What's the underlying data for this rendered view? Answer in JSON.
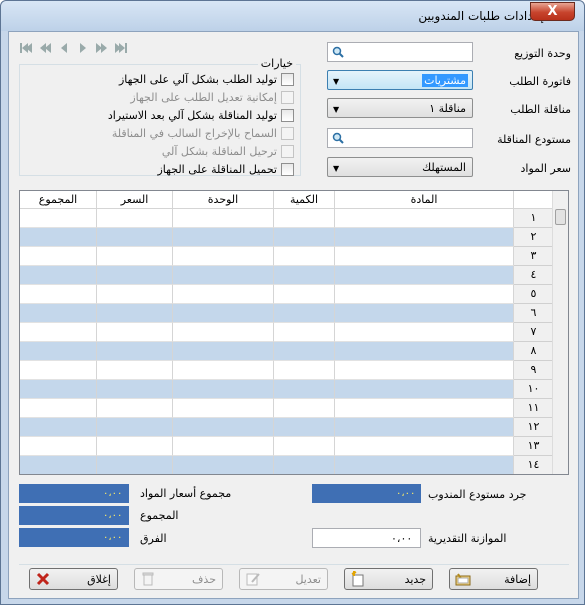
{
  "window": {
    "title": "إعدادات طلبات المندوبين",
    "close_label": "X"
  },
  "nav": {
    "first": "first-record",
    "prev": "prev-record",
    "next": "next-record",
    "last": "last-record"
  },
  "options": {
    "title": "خيارات",
    "items": [
      {
        "label": "توليد الطلب بشكل آلي على الجهاز",
        "enabled": true
      },
      {
        "label": "إمكانية تعديل الطلب على الجهاز",
        "enabled": false
      },
      {
        "label": "توليد المناقلة بشكل آلي بعد الاستيراد",
        "enabled": true
      },
      {
        "label": "السماح بالإخراج السالب في المناقلة",
        "enabled": false
      },
      {
        "label": "ترحيل المناقلة بشكل آلي",
        "enabled": false
      },
      {
        "label": "تحميل المناقلة على الجهاز",
        "enabled": true
      }
    ]
  },
  "fields": {
    "distribution_unit": {
      "label": "وحدة التوزيع",
      "value": ""
    },
    "order_invoice": {
      "label": "فاتورة الطلب",
      "value": "مشتريات"
    },
    "order_transfer": {
      "label": "مناقلة الطلب",
      "value": "مناقلة ١"
    },
    "transfer_warehouse": {
      "label": "مستودع المناقلة",
      "value": ""
    },
    "material_price": {
      "label": "سعر المواد",
      "value": "المستهلك"
    }
  },
  "grid": {
    "columns": [
      "المجموع",
      "السعر",
      "الوحدة",
      "الكمية",
      "المادة"
    ],
    "row_numbers": [
      "١",
      "٢",
      "٣",
      "٤",
      "٥",
      "٦",
      "٧",
      "٨",
      "٩",
      "١٠",
      "١١",
      "١٢",
      "١٣",
      "١٤"
    ]
  },
  "totals": {
    "materials_prices_total": {
      "label": "مجموع أسعار المواد",
      "value": "٠،٠٠"
    },
    "total": {
      "label": "المجموع",
      "value": "٠،٠٠"
    },
    "difference": {
      "label": "الفرق",
      "value": "٠،٠٠"
    },
    "rep_warehouse_inventory": {
      "label": "جرد مستودع المندوب",
      "value": "٠،٠٠"
    },
    "estimated_budget": {
      "label": "الموازنة التقديرية",
      "value": "٠،٠٠"
    }
  },
  "buttons": {
    "add": "إضافة",
    "new": "جديد",
    "edit": "تعديل",
    "delete": "حذف",
    "close": "إغلاق"
  },
  "colors": {
    "accent": "#3f6fb4",
    "total_text": "#ffee66",
    "row_alt": "#c4d7eb",
    "close": "#c7442d"
  }
}
